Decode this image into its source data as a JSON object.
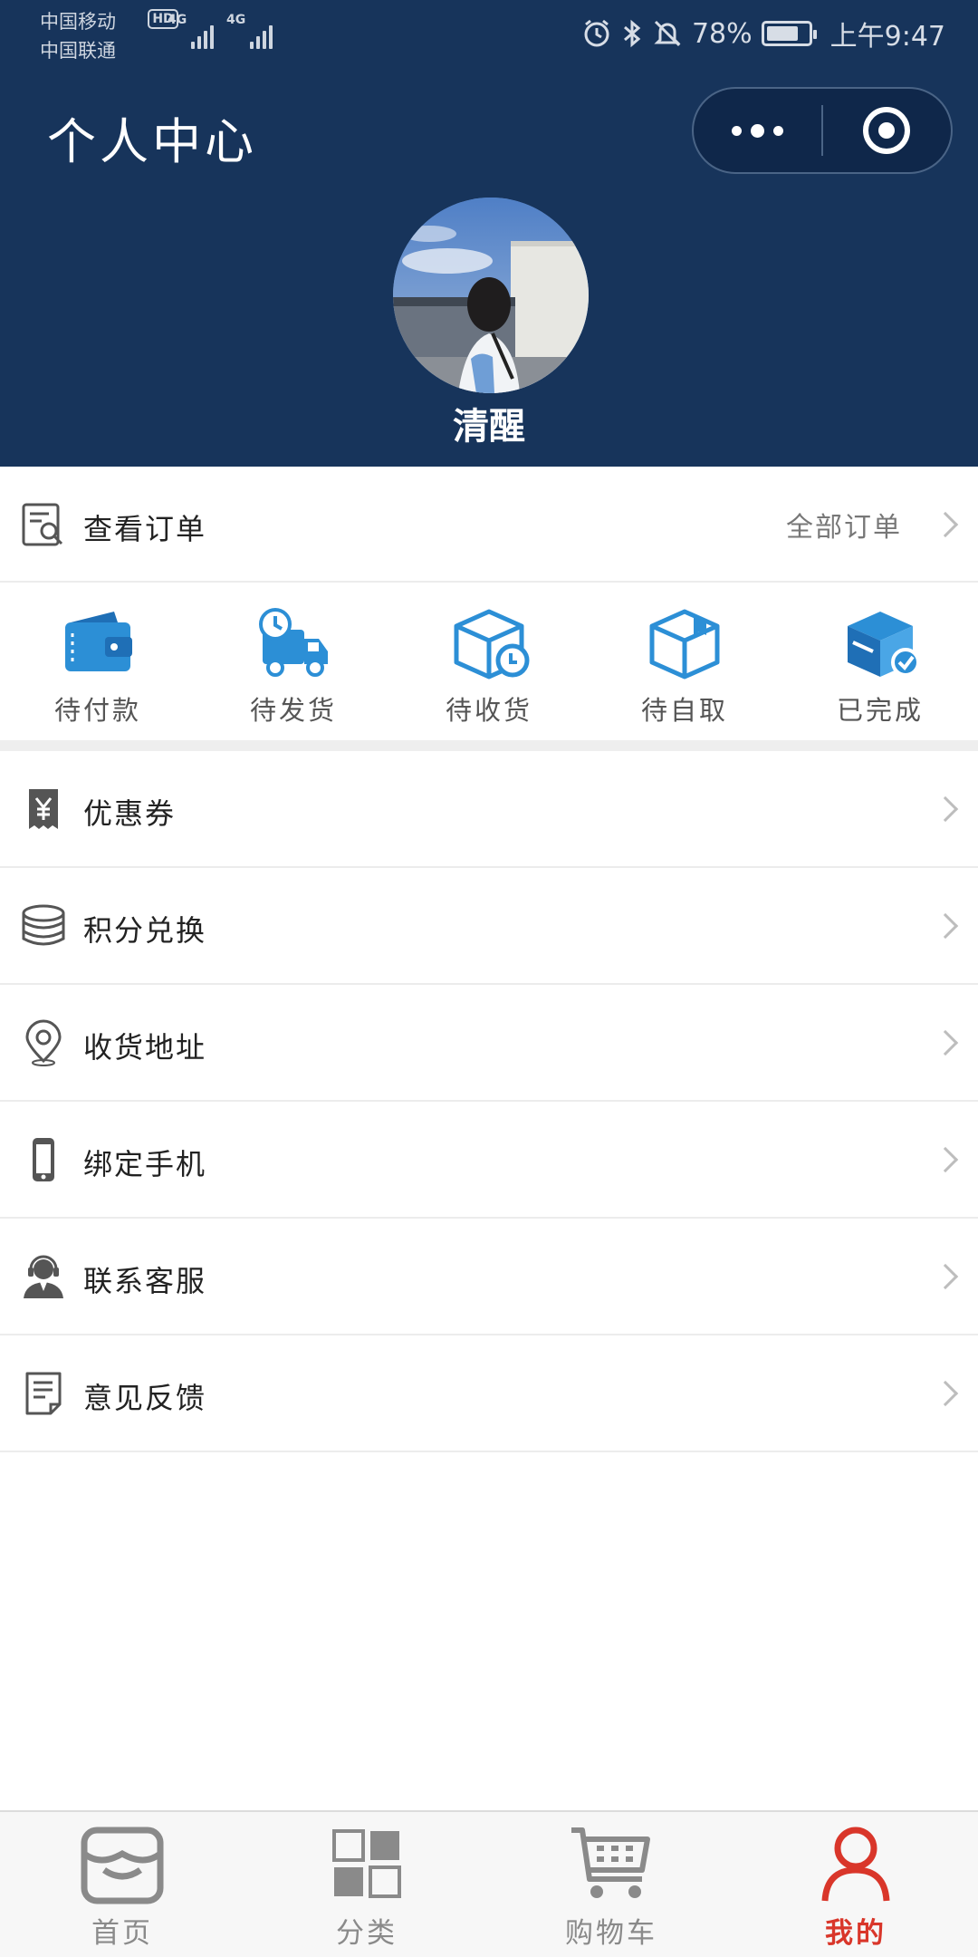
{
  "status_bar": {
    "carrier_1": "中国移动",
    "carrier_2": "中国联通",
    "hd": "HD",
    "network_1": "4G",
    "network_2": "4G",
    "battery": "78%",
    "battery_level": 0.78,
    "time": "上午9:47"
  },
  "header": {
    "title": "个人中心",
    "username": "清醒"
  },
  "orders": {
    "label": "查看订单",
    "all_label": "全部订单",
    "statuses": [
      {
        "label": "待付款",
        "icon": "wallet-icon"
      },
      {
        "label": "待发货",
        "icon": "delivery-truck-icon"
      },
      {
        "label": "待收货",
        "icon": "package-clock-icon"
      },
      {
        "label": "待自取",
        "icon": "open-box-icon"
      },
      {
        "label": "已完成",
        "icon": "box-check-icon"
      }
    ]
  },
  "menu": [
    {
      "label": "优惠券",
      "icon": "coupon-icon"
    },
    {
      "label": "积分兑换",
      "icon": "coins-stack-icon"
    },
    {
      "label": "收货地址",
      "icon": "location-pin-icon"
    },
    {
      "label": "绑定手机",
      "icon": "phone-icon"
    },
    {
      "label": "联系客服",
      "icon": "customer-service-icon"
    },
    {
      "label": "意见反馈",
      "icon": "feedback-document-icon"
    }
  ],
  "tabbar": [
    {
      "label": "首页",
      "icon": "store-icon",
      "active": false
    },
    {
      "label": "分类",
      "icon": "category-grid-icon",
      "active": false
    },
    {
      "label": "购物车",
      "icon": "cart-icon",
      "active": false
    },
    {
      "label": "我的",
      "icon": "person-icon",
      "active": true
    }
  ],
  "colors": {
    "header_bg": "#17345b",
    "accent_blue": "#2c8fd6",
    "tab_active": "#d9362a"
  }
}
